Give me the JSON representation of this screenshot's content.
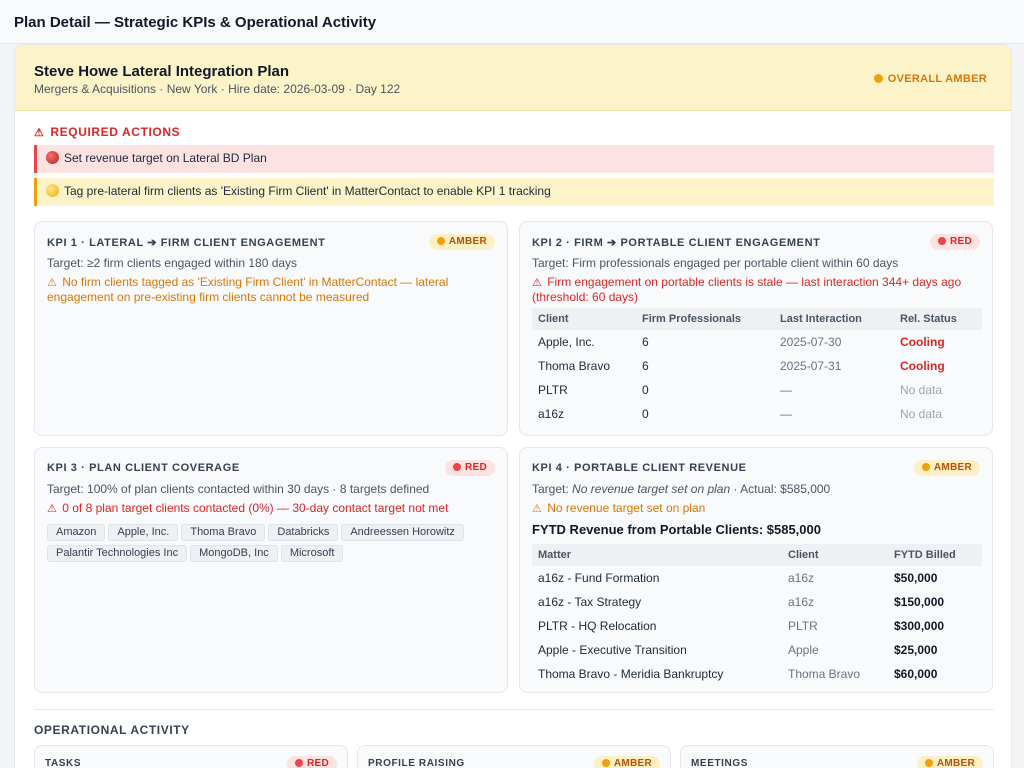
{
  "page": {
    "title": "Plan Detail — Strategic KPIs & Operational Activity"
  },
  "plan": {
    "name": "Steve Howe Lateral Integration Plan",
    "subtitle": "Mergers & Acquisitions · New York · Hire date: 2026-03-09 · Day 122",
    "overall_status": "OVERALL AMBER"
  },
  "required_actions": {
    "label": "REQUIRED ACTIONS",
    "items": [
      {
        "text": "Set revenue target on Lateral BD Plan",
        "severity": "red"
      },
      {
        "text": "Tag pre-lateral firm clients as 'Existing Firm Client' in MatterContact to enable KPI 1 tracking",
        "severity": "yellow"
      }
    ]
  },
  "kpi1": {
    "title": "KPI 1 · LATERAL ➔ FIRM CLIENT ENGAGEMENT",
    "status": "AMBER",
    "target": "Target: ≥2 firm clients engaged within 180 days",
    "warning_line1": "No firm clients tagged as 'Existing Firm Client' in MatterContact — lateral",
    "warning_line2": "engagement on pre-existing firm clients cannot be measured"
  },
  "kpi2": {
    "title": "KPI 2 · FIRM ➔ PORTABLE CLIENT ENGAGEMENT",
    "status": "RED",
    "target": "Target: Firm professionals engaged per portable client within 60 days",
    "warning_line1": "Firm engagement on portable clients is stale — last interaction 344+ days ago",
    "warning_line2": "(threshold: 60 days)",
    "columns": [
      "Client",
      "Firm Professionals",
      "Last Interaction",
      "Rel. Status"
    ],
    "rows": [
      {
        "client": "Apple, Inc.",
        "pros": "6",
        "last": "2025-07-30",
        "status": "Cooling"
      },
      {
        "client": "Thoma Bravo",
        "pros": "6",
        "last": "2025-07-31",
        "status": "Cooling"
      },
      {
        "client": "PLTR",
        "pros": "0",
        "last": "—",
        "status": "No data"
      },
      {
        "client": "a16z",
        "pros": "0",
        "last": "—",
        "status": "No data"
      }
    ]
  },
  "kpi3": {
    "title": "KPI 3 · PLAN CLIENT COVERAGE",
    "status": "RED",
    "target": "Target: 100% of plan clients contacted within 30 days · 8 targets defined",
    "warning": "0 of 8 plan target clients contacted (0%) — 30-day contact target not met",
    "clients_row1": [
      "Amazon",
      "Apple, Inc.",
      "Thoma Bravo",
      "Databricks",
      "Andreessen Horowitz"
    ],
    "clients_row2": [
      "Palantir Technologies Inc",
      "MongoDB, Inc",
      "Microsoft"
    ]
  },
  "kpi4": {
    "title": "KPI 4 · PORTABLE CLIENT REVENUE",
    "status": "AMBER",
    "target_prefix": "Target:",
    "target_value": "No revenue target set on plan",
    "target_suffix": "· Actual: $585,000",
    "warning": "No revenue target set on plan",
    "revenue_title": "FYTD Revenue from Portable Clients: $585,000",
    "columns": [
      "Matter",
      "Client",
      "FYTD Billed"
    ],
    "rows": [
      {
        "matter": "a16z - Fund Formation",
        "client": "a16z",
        "billed": "$50,000"
      },
      {
        "matter": "a16z - Tax Strategy",
        "client": "a16z",
        "billed": "$150,000"
      },
      {
        "matter": "PLTR - HQ Relocation",
        "client": "PLTR",
        "billed": "$300,000"
      },
      {
        "matter": "Apple - Executive Transition",
        "client": "Apple",
        "billed": "$25,000"
      },
      {
        "matter": "Thoma Bravo - Meridia Bankruptcy",
        "client": "Thoma Bravo",
        "billed": "$60,000"
      }
    ]
  },
  "operational": {
    "label": "OPERATIONAL ACTIVITY",
    "cards": [
      {
        "title": "TASKS",
        "status": "RED"
      },
      {
        "title": "PROFILE RAISING",
        "status": "AMBER"
      },
      {
        "title": "MEETINGS",
        "status": "AMBER"
      }
    ]
  },
  "icons": {
    "warning": "warning-triangle-icon",
    "status_dot": "status-dot-icon"
  },
  "colors": {
    "amber": "#f59e0b",
    "red": "#ef4444",
    "header_bg": "#fdf3c9"
  }
}
